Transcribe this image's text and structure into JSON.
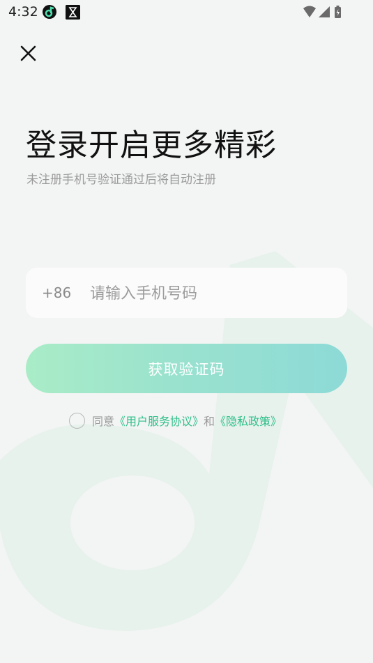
{
  "status_bar": {
    "time": "4:32"
  },
  "login": {
    "close_icon": "close-icon",
    "title": "登录开启更多精彩",
    "subtitle": "未注册手机号验证通过后将自动注册",
    "country_code": "+86",
    "phone_placeholder": "请输入手机号码",
    "get_code_label": "获取验证码",
    "agreement": {
      "prefix": "同意",
      "user_agreement": "《用户服务协议》",
      "and": "和",
      "privacy_policy": "《隐私政策》"
    }
  },
  "colors": {
    "accent": "#2ebf8a",
    "button_start": "#a9ecc7",
    "button_end": "#8ddad7"
  }
}
